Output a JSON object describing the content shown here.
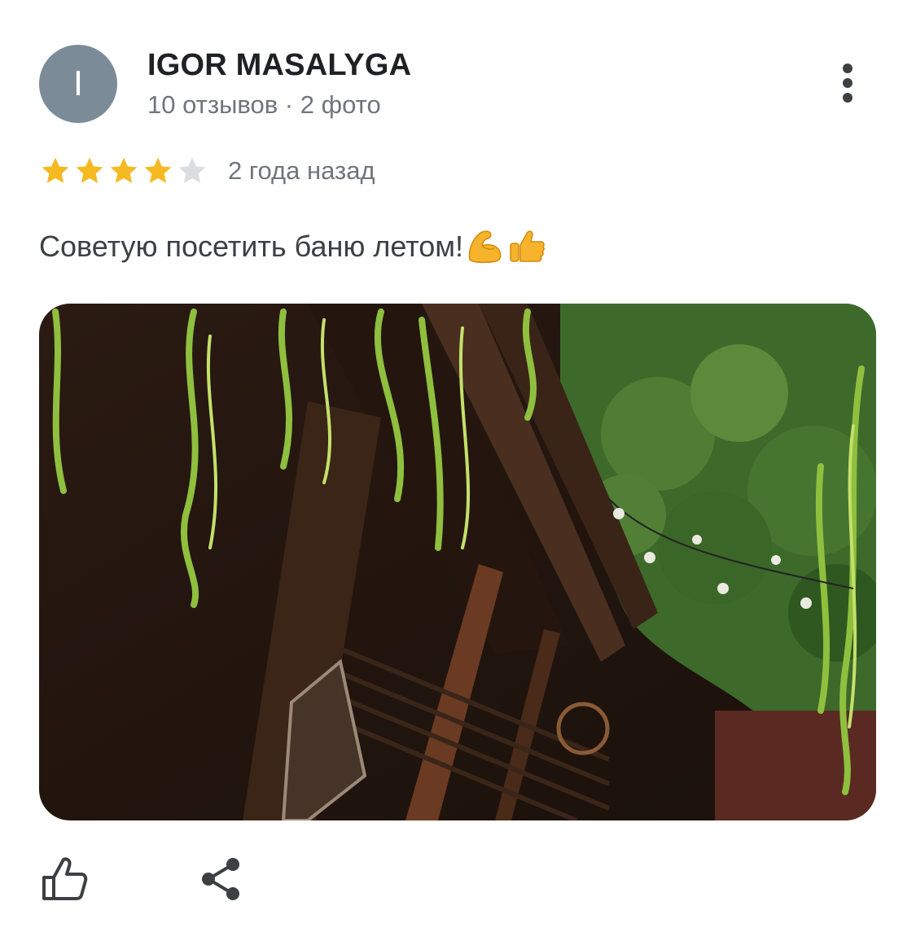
{
  "review": {
    "author": {
      "initial": "I",
      "name": "IGOR MASALYGA",
      "meta": "10 отзывов · 2 фото",
      "avatar_color": "#7b8c98"
    },
    "rating": 4,
    "rating_max": 5,
    "date": "2 года назад",
    "text": "Советую посетить баню летом!",
    "emojis": [
      "flexed-biceps",
      "thumbs-up"
    ],
    "photo": {
      "description_icon": "photo-thumbnail"
    }
  },
  "colors": {
    "star_filled": "#f5b921",
    "star_empty": "#dadce0",
    "text_primary": "#202124",
    "text_secondary": "#70757a"
  },
  "icons": {
    "more": "more-vert-icon",
    "like": "thumb-up-icon",
    "share": "share-icon"
  }
}
